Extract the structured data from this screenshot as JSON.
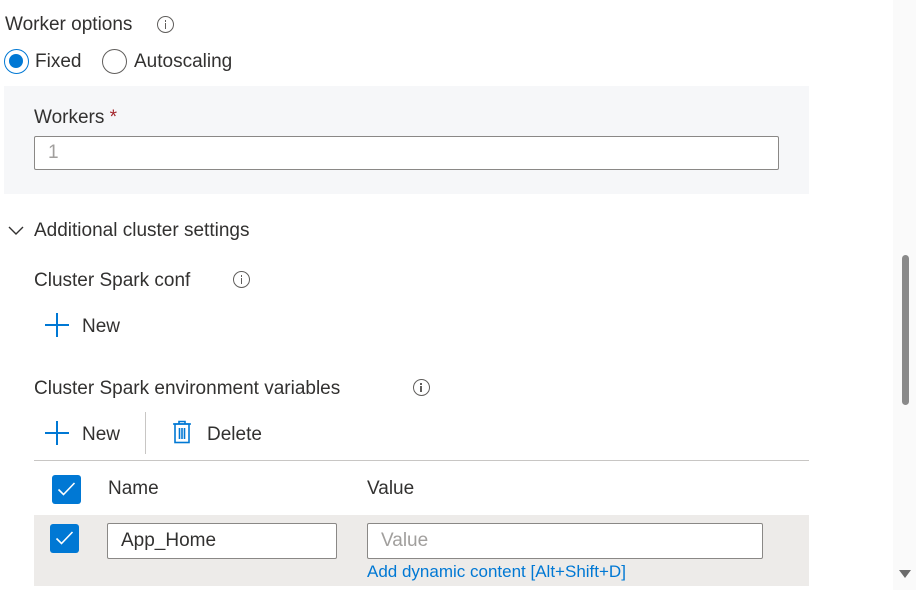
{
  "worker_options": {
    "label": "Worker options",
    "info_icon": "info-icon",
    "options": [
      {
        "label": "Fixed",
        "selected": true
      },
      {
        "label": "Autoscaling",
        "selected": false
      }
    ]
  },
  "workers": {
    "label": "Workers",
    "required_marker": "*",
    "value": "1"
  },
  "additional_settings": {
    "label": "Additional cluster settings",
    "expanded": true,
    "chevron_icon": "chevron-down-icon"
  },
  "spark_conf": {
    "label": "Cluster Spark conf",
    "info_icon": "info-icon",
    "new_label": "New",
    "new_icon": "plus-icon"
  },
  "env_vars": {
    "label": "Cluster Spark environment variables",
    "info_icon": "info-icon",
    "toolbar": {
      "new_label": "New",
      "new_icon": "plus-icon",
      "delete_label": "Delete",
      "delete_icon": "trash-icon"
    },
    "table": {
      "select_all_checked": true,
      "columns": [
        "Name",
        "Value"
      ],
      "rows": [
        {
          "checked": true,
          "name": "App_Home",
          "value": "",
          "value_placeholder": "Value",
          "dynamic_content_link": "Add dynamic content [Alt+Shift+D]"
        }
      ]
    }
  },
  "colors": {
    "accent": "#0078d4",
    "required": "#a4262c",
    "text": "#323130",
    "panel_bg": "#f6f7f9",
    "row_selected_bg": "#edebe9"
  }
}
